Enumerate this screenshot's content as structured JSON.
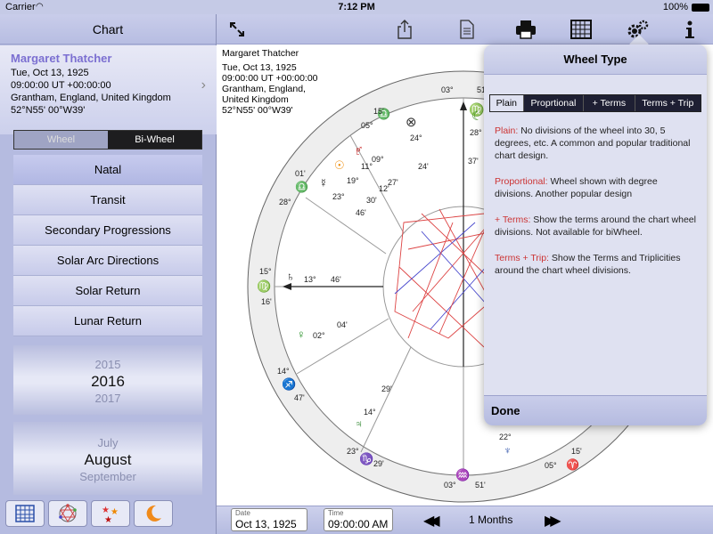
{
  "status_bar": {
    "carrier": "Carrier",
    "time": "7:12 PM",
    "battery": "100%"
  },
  "sidebar": {
    "title": "Chart",
    "person": {
      "name": "Margaret Thatcher",
      "date": "Tue, Oct 13, 1925",
      "time": "09:00:00 UT +00:00:00",
      "place": "Grantham, England, United Kingdom",
      "coords": "52°N55' 00°W39'"
    },
    "segment": {
      "left": "Wheel",
      "right": "Bi-Wheel"
    },
    "menu": [
      "Natal",
      "Transit",
      "Secondary Progressions",
      "Solar Arc Directions",
      "Solar Return",
      "Lunar Return"
    ],
    "year_picker": {
      "prev": "2015",
      "selected": "2016",
      "next": "2017"
    },
    "month_picker": {
      "prev": "July",
      "selected": "August",
      "next": "September"
    }
  },
  "chart": {
    "info": [
      "Margaret Thatcher",
      "Tue, Oct 13, 1925",
      "09:00:00 UT +00:00:00",
      "Grantham, England,",
      "United Kingdom",
      "52°N55' 00°W39'"
    ],
    "outer_labels": [
      "03°",
      "51'",
      "30'",
      "05°",
      "15'",
      "01'",
      "28°",
      "15°",
      "16'",
      "14°",
      "47'",
      "23°",
      "29'",
      "51'",
      "03°",
      "05°",
      "15'"
    ],
    "planet_labels": [
      "24°",
      "24'",
      "28°",
      "37'",
      "09°",
      "11°",
      "27'",
      "19°",
      "12'",
      "23°",
      "30'",
      "46'",
      "13°",
      "46'",
      "02°",
      "04'",
      "29'",
      "14°",
      "22°"
    ]
  },
  "bottom": {
    "date_label": "Date",
    "date_value": "Oct 13, 1925",
    "time_label": "Time",
    "time_value": "09:00:00 AM",
    "step": "1 Months"
  },
  "popover": {
    "title": "Wheel Type",
    "tabs": [
      "Plain",
      "Proprtional",
      "+ Terms",
      "Terms + Trip"
    ],
    "descriptions": [
      {
        "key": "Plain:",
        "text": "No divisions of the wheel into 30, 5 degrees, etc. A common and popular traditional chart design."
      },
      {
        "key": "Proportional:",
        "text": "Wheel shown with degree divisions. Another popular design"
      },
      {
        "key": "+ Terms:",
        "text": "Show the terms around the chart wheel divisions. Not available for biWheel."
      },
      {
        "key": "Terms + Trip:",
        "text": "Show the Terms and Triplicities around the chart wheel divisions."
      }
    ],
    "done": "Done"
  },
  "icons": [
    "expand-icon",
    "share-icon",
    "document-icon",
    "printer-icon",
    "grid-icon",
    "gear-icon",
    "info-icon"
  ]
}
